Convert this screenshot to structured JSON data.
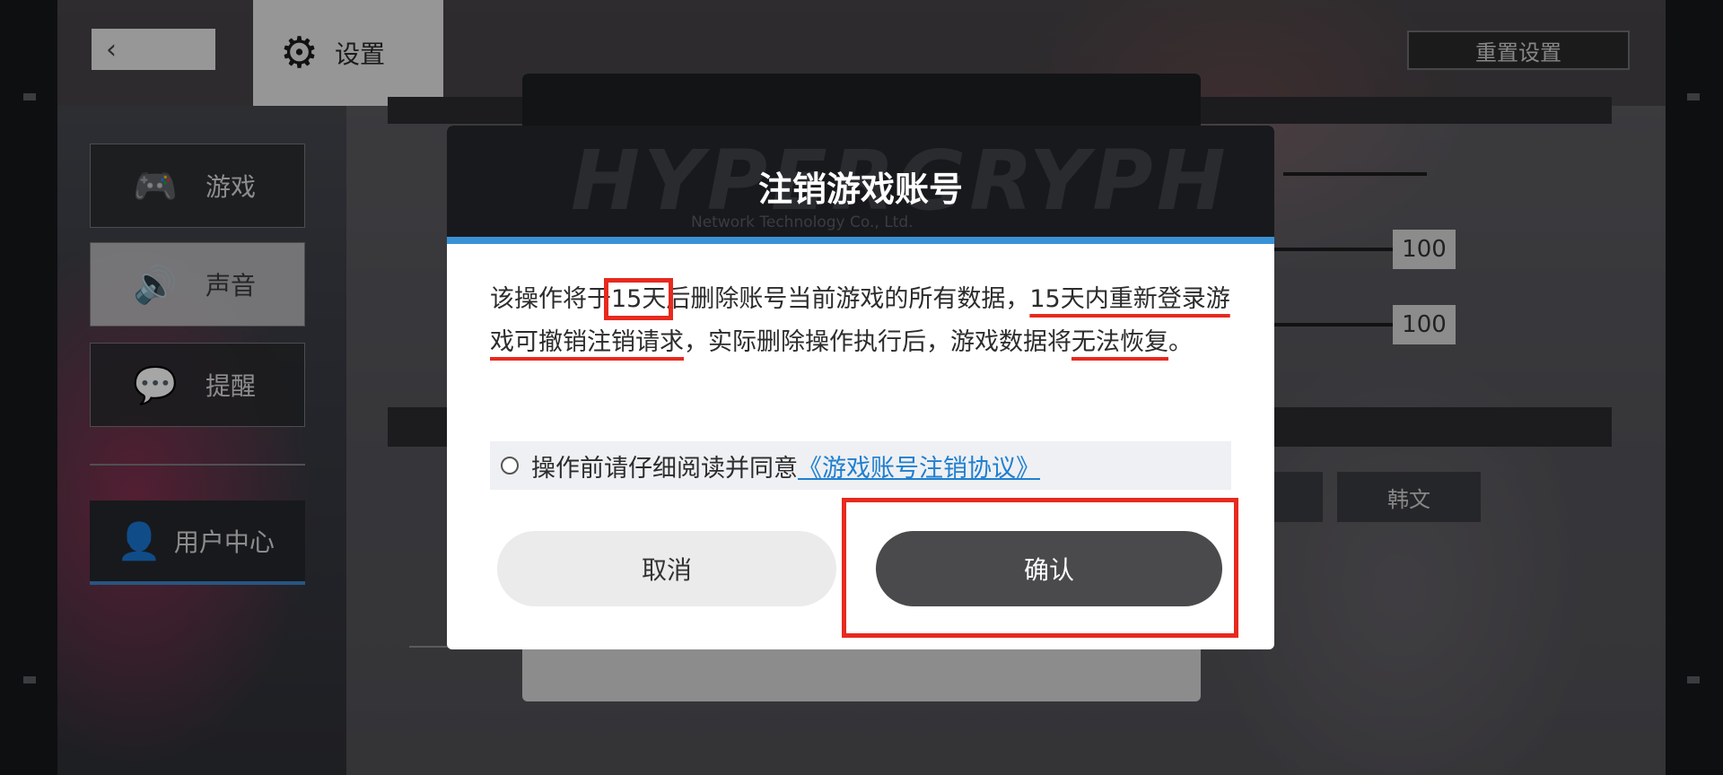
{
  "header": {
    "settings_label": "设置",
    "reset_label": "重置设置"
  },
  "sidebar": {
    "items": [
      {
        "label": "游戏",
        "icon": "gamepad-icon"
      },
      {
        "label": "声音",
        "icon": "speaker-icon"
      },
      {
        "label": "提醒",
        "icon": "notification-icon"
      }
    ],
    "user_center": "用户中心"
  },
  "main": {
    "slider_values": [
      "100",
      "100"
    ],
    "lang_option": "韩文"
  },
  "dialog": {
    "watermark": "HYPERGRYPH",
    "watermark_sub": "Network Technology Co., Ltd.",
    "title": "注销游戏账号",
    "body": {
      "p1": "该操作将于",
      "days": "15天",
      "p2": "后删除账号当前游戏的所有数据，",
      "u1": "15天内重新登录游戏可撤销注销请求",
      "p3": "，实际删除操作执行后，游戏数据将",
      "u2": "无法恢复",
      "p4": "。"
    },
    "agree_text": "操作前请仔细阅读并同意",
    "agree_link": "《游戏账号注销协议》",
    "cancel_label": "取消",
    "confirm_label": "确认"
  },
  "colors": {
    "accent_blue": "#3a92d6",
    "annotation_red": "#e8291e",
    "confirm_button": "#4a4a4c"
  }
}
